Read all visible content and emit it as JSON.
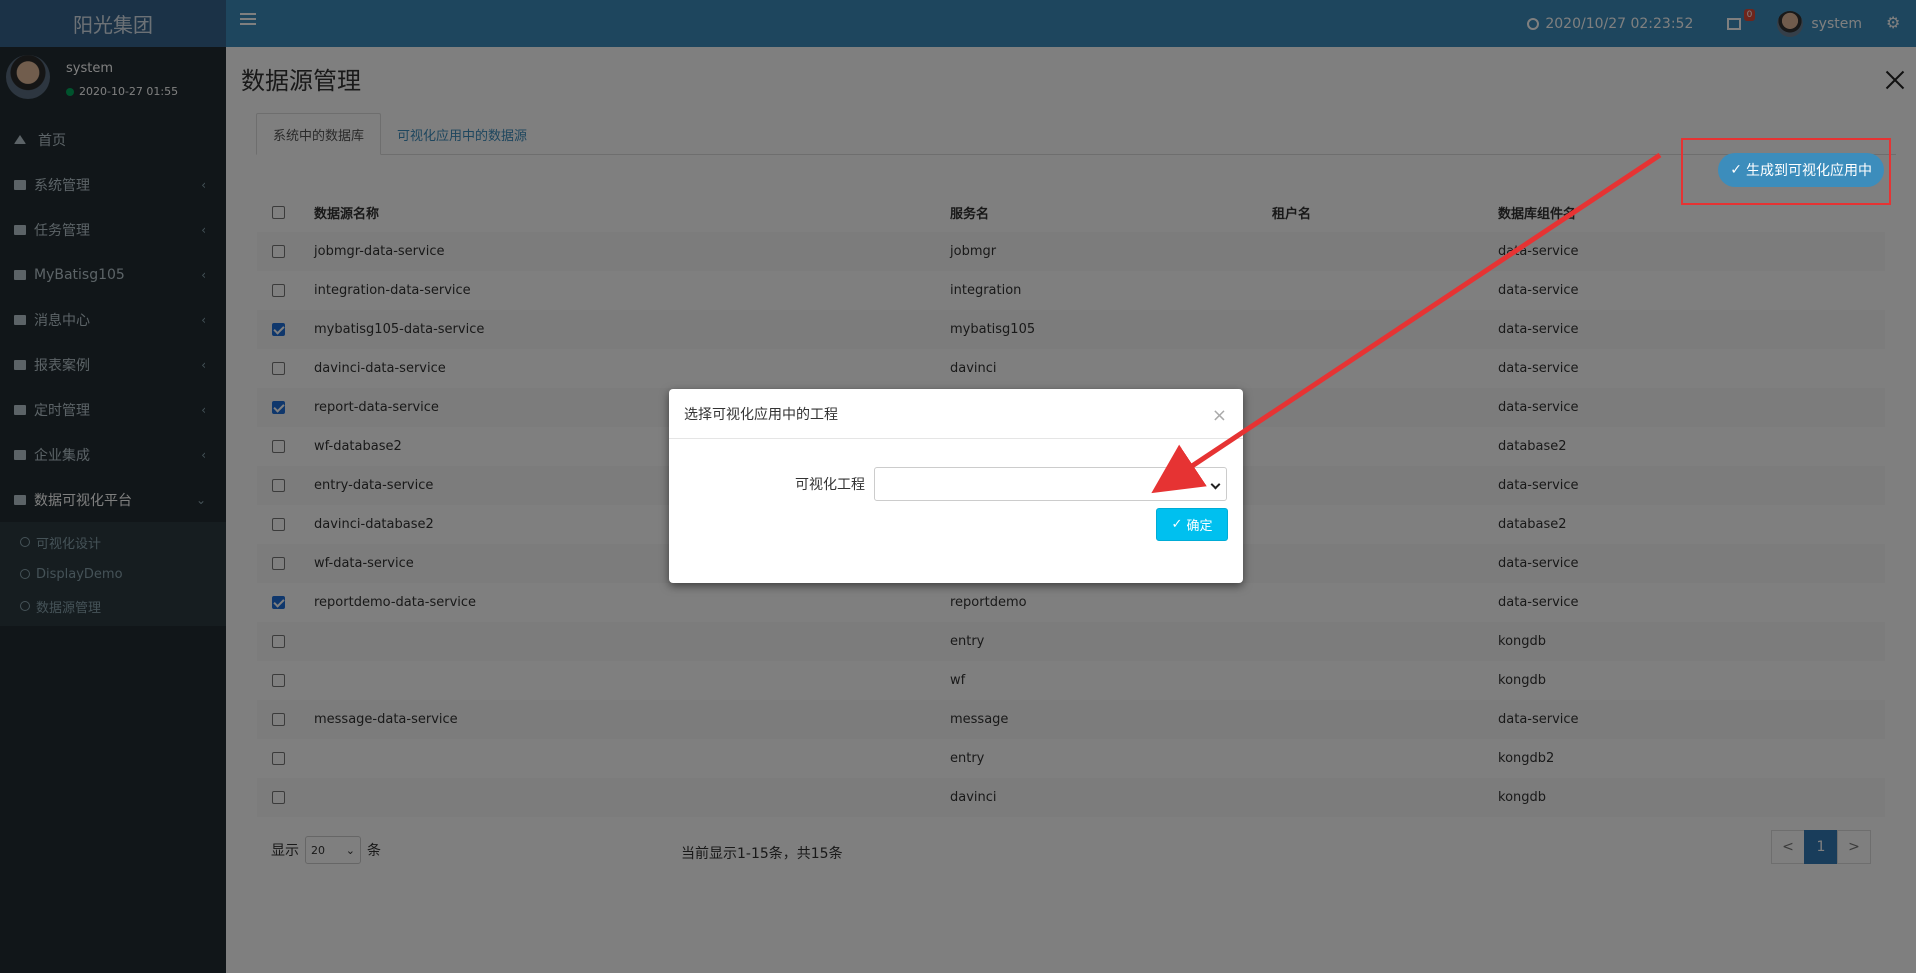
{
  "app": {
    "brand": "阳光集团"
  },
  "header": {
    "datetime": "2020/10/27 02:23:52",
    "notif_count": "0",
    "user": "system"
  },
  "sidebar": {
    "user": {
      "name": "system",
      "status": "2020-10-27 01:55"
    },
    "items": [
      {
        "label": "首页"
      },
      {
        "label": "系统管理"
      },
      {
        "label": "任务管理"
      },
      {
        "label": "MyBatisg105"
      },
      {
        "label": "消息中心"
      },
      {
        "label": "报表案例"
      },
      {
        "label": "定时管理"
      },
      {
        "label": "企业集成"
      },
      {
        "label": "数据可视化平台"
      }
    ],
    "subitems": [
      {
        "label": "可视化设计"
      },
      {
        "label": "DisplayDemo"
      },
      {
        "label": "数据源管理"
      }
    ]
  },
  "page": {
    "title": "数据源管理",
    "tabs": [
      {
        "label": "系统中的数据库"
      },
      {
        "label": "可视化应用中的数据源"
      }
    ],
    "generate_btn": "生成到可视化应用中"
  },
  "table": {
    "headers": {
      "name": "数据源名称",
      "service": "服务名",
      "tenant": "租户名",
      "component": "数据库组件名"
    },
    "rows": [
      {
        "checked": false,
        "name": "jobmgr-data-service",
        "service": "jobmgr",
        "tenant": "",
        "component": "data-service"
      },
      {
        "checked": false,
        "name": "integration-data-service",
        "service": "integration",
        "tenant": "",
        "component": "data-service"
      },
      {
        "checked": true,
        "name": "mybatisg105-data-service",
        "service": "mybatisg105",
        "tenant": "",
        "component": "data-service"
      },
      {
        "checked": false,
        "name": "davinci-data-service",
        "service": "davinci",
        "tenant": "",
        "component": "data-service"
      },
      {
        "checked": true,
        "name": "report-data-service",
        "service": "",
        "tenant": "",
        "component": "data-service"
      },
      {
        "checked": false,
        "name": "wf-database2",
        "service": "",
        "tenant": "",
        "component": "database2"
      },
      {
        "checked": false,
        "name": "entry-data-service",
        "service": "",
        "tenant": "",
        "component": "data-service"
      },
      {
        "checked": false,
        "name": "davinci-database2",
        "service": "",
        "tenant": "",
        "component": "database2"
      },
      {
        "checked": false,
        "name": "wf-data-service",
        "service": "",
        "tenant": "",
        "component": "data-service"
      },
      {
        "checked": true,
        "name": "reportdemo-data-service",
        "service": "reportdemo",
        "tenant": "",
        "component": "data-service"
      },
      {
        "checked": false,
        "name": "",
        "service": "entry",
        "tenant": "",
        "component": "kongdb"
      },
      {
        "checked": false,
        "name": "",
        "service": "wf",
        "tenant": "",
        "component": "kongdb"
      },
      {
        "checked": false,
        "name": "message-data-service",
        "service": "message",
        "tenant": "",
        "component": "data-service"
      },
      {
        "checked": false,
        "name": "",
        "service": "entry",
        "tenant": "",
        "component": "kongdb2"
      },
      {
        "checked": false,
        "name": "",
        "service": "davinci",
        "tenant": "",
        "component": "kongdb"
      }
    ]
  },
  "pagination": {
    "show_label": "显示",
    "page_size": "20",
    "unit": "条",
    "info": "当前显示1-15条，共15条",
    "prev": "<",
    "current": "1",
    "next": ">"
  },
  "modal": {
    "title": "选择可视化应用中的工程",
    "field_label": "可视化工程",
    "field_value": "",
    "ok_label": "确定",
    "close": "×"
  },
  "colors": {
    "header": "#3c8dbc",
    "sidebar": "#222d32",
    "annotation": "#e63333",
    "ok_button": "#00c0ef"
  }
}
